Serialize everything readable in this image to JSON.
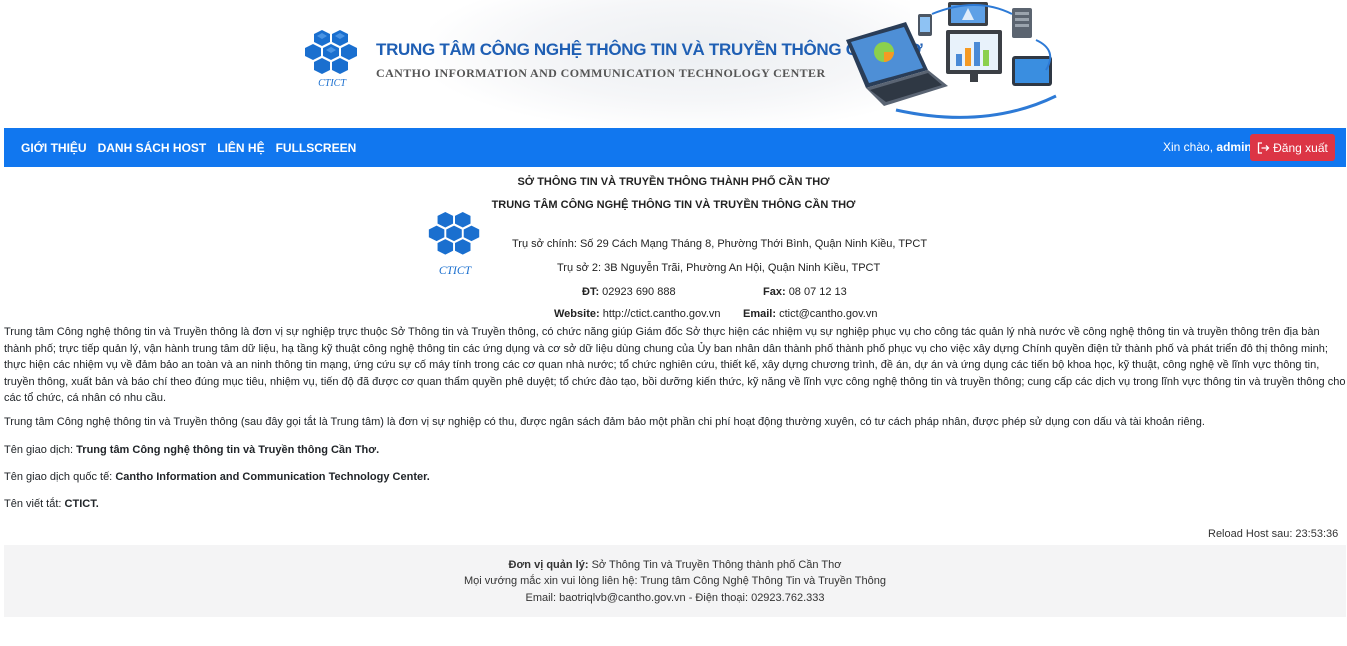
{
  "banner": {
    "logo_text": "CTICT",
    "title": "TRUNG TÂM CÔNG NGHỆ THÔNG TIN VÀ TRUYỀN THÔNG CẦN THƠ",
    "subtitle": "CANTHO INFORMATION AND COMMUNICATION TECHNOLOGY CENTER"
  },
  "nav": {
    "links": [
      "GIỚI THIỆU",
      "DANH SÁCH HOST",
      "LIÊN HỆ",
      "FULLSCREEN"
    ],
    "greeting_prefix": "Xin chào,",
    "username": "admin",
    "logout_label": "Đăng xuất"
  },
  "info": {
    "org_parent": "SỞ THÔNG TIN VÀ TRUYỀN THÔNG THÀNH PHỐ CẦN THƠ",
    "org_name": "TRUNG TÂM CÔNG NGHỆ THÔNG TIN VÀ TRUYỀN THÔNG CẦN THƠ",
    "address_main": "Trụ sở chính: Số 29 Cách Mạng Tháng 8, Phường Thới Bình, Quận Ninh Kiều, TPCT",
    "address_second": "Trụ sở 2: 3B Nguyễn Trãi, Phường An Hội, Quận Ninh Kiều, TPCT",
    "phone_label": "ĐT:",
    "phone_value": "02923 690 888",
    "fax_label": "Fax:",
    "fax_value": "08 07 12 13",
    "website_label": "Website:",
    "website_value": "http://ctict.cantho.gov.vn",
    "email_label": "Email:",
    "email_value": "ctict@cantho.gov.vn"
  },
  "content": {
    "para1": "Trung tâm Công nghệ thông tin và Truyền thông là đơn vị sự nghiệp trực thuộc Sở Thông tin và Truyền thông, có chức năng giúp Giám đốc Sở thực hiện các nhiệm vụ sự nghiệp phục vụ cho công tác quản lý nhà nước về công nghệ thông tin và truyền thông trên địa bàn thành phố; trực tiếp quản lý, vận hành trung tâm dữ liệu, hạ tầng kỹ thuật công nghệ thông tin các ứng dụng và cơ sở dữ liệu dùng chung của Ủy ban nhân dân thành phố thành phố phục vụ cho việc xây dựng Chính quyền điện tử thành phố và phát triển đô thị thông minh; thực hiện các nhiệm vụ về đảm bảo an toàn và an ninh thông tin mạng, ứng cứu sự cố máy tính trong các cơ quan nhà nước; tổ chức nghiên cứu, thiết kế, xây dựng chương trình, đề án, dự án và ứng dụng các tiến bộ khoa học, kỹ thuật, công nghệ về lĩnh vực thông tin, truyền thông, xuất bản và báo chí theo đúng mục tiêu, nhiệm vụ, tiến độ đã được cơ quan thẩm quyền phê duyệt; tổ chức đào tạo, bồi dưỡng kiến thức, kỹ năng về lĩnh vực công nghệ thông tin và truyền thông; cung cấp các dịch vụ trong lĩnh vực thông tin và truyền thông cho các tổ chức, cá nhân có nhu cầu.",
    "para2": "Trung tâm Công nghệ thông tin và Truyền thông (sau đây gọi tắt là Trung tâm) là đơn vị sự nghiệp có thu, được ngân sách đảm bảo một phần chi phí hoạt động thường xuyên, có tư cách pháp nhân, được phép sử dụng con dấu và tài khoản riêng.",
    "trade_label": "Tên giao dịch:",
    "trade_value": "Trung tâm Công nghệ thông tin và Truyền thông Cần Thơ.",
    "intl_label": "Tên giao dịch quốc tế:",
    "intl_value": "Cantho Information and Communication Technology Center.",
    "abbr_label": "Tên viết tắt:",
    "abbr_value": "CTICT."
  },
  "reload_text": "Reload Host sau: 23:53:36",
  "footer": {
    "manager_label": "Đơn vị quản lý:",
    "manager_value": "Sở Thông Tin và Truyền Thông thành phố Cần Thơ",
    "contact_line": "Mọi vướng mắc xin vui lòng liên hệ: Trung tâm Công Nghệ Thông Tin và Truyền Thông",
    "email_phone_line": "Email: baotriqlvb@cantho.gov.vn - Điện thoại: 02923.762.333"
  },
  "colors": {
    "navbar": "#1177ef",
    "logout": "#dc3545",
    "banner_title": "#1f5fb4",
    "footer_bg": "#f4f4f5"
  }
}
